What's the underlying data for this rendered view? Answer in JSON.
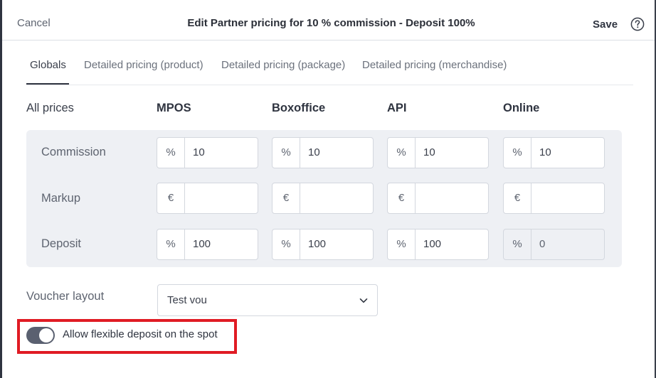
{
  "header": {
    "cancel_label": "Cancel",
    "title": "Edit Partner pricing for 10 % commission - Deposit 100%",
    "save_label": "Save",
    "help_icon": "question-circle-icon"
  },
  "tabs": [
    {
      "label": "Globals",
      "active": true
    },
    {
      "label": "Detailed pricing (product)",
      "active": false
    },
    {
      "label": "Detailed pricing (package)",
      "active": false
    },
    {
      "label": "Detailed pricing (merchandise)",
      "active": false
    }
  ],
  "grid": {
    "row_header": "All prices",
    "columns": [
      "MPOS",
      "Boxoffice",
      "API",
      "Online"
    ],
    "rows": [
      {
        "label": "Commission",
        "prefix": "%",
        "values": [
          "10",
          "10",
          "10",
          "10"
        ],
        "disabled": [
          false,
          false,
          false,
          false
        ]
      },
      {
        "label": "Markup",
        "prefix": "€",
        "values": [
          "",
          "",
          "",
          ""
        ],
        "disabled": [
          false,
          false,
          false,
          false
        ]
      },
      {
        "label": "Deposit",
        "prefix": "%",
        "values": [
          "100",
          "100",
          "100",
          "0"
        ],
        "disabled": [
          false,
          false,
          false,
          true
        ]
      }
    ]
  },
  "voucher": {
    "label": "Voucher layout",
    "selected": "Test vou",
    "chevron_icon": "chevron-down-icon"
  },
  "flexible_deposit": {
    "label": "Allow flexible deposit on the spot",
    "enabled": true
  },
  "colors": {
    "highlight": "#e01b24",
    "toggle_on": "#5a6070",
    "panel_bg": "#eef0f4"
  }
}
